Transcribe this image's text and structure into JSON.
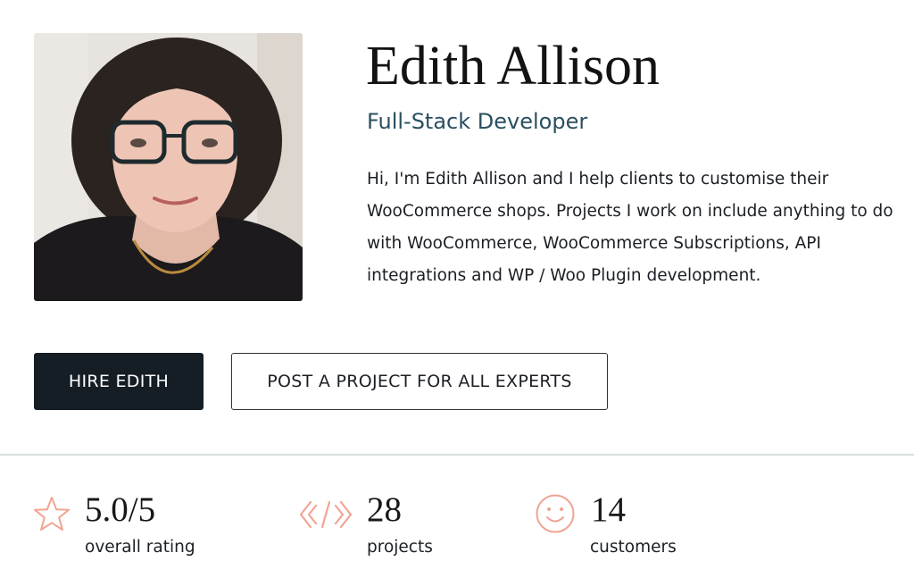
{
  "profile": {
    "name": "Edith Allison",
    "role": "Full-Stack Developer",
    "bio": "Hi, I'm Edith Allison and I help clients to customise their WooCommerce shops. Projects I work on include anything to do with WooCommerce, WooCommerce Subscriptions, API integrations and WP / Woo Plugin development."
  },
  "actions": {
    "hire_label": "HIRE EDITH",
    "post_label": "POST A PROJECT FOR ALL EXPERTS"
  },
  "stats": [
    {
      "icon": "star-icon",
      "value": "5.0/5",
      "label": "overall rating"
    },
    {
      "icon": "code-icon",
      "value": "28",
      "label": "projects"
    },
    {
      "icon": "smiley-icon",
      "value": "14",
      "label": "customers"
    }
  ],
  "colors": {
    "accent_icon": "#f0a493",
    "role_text": "#2b4f60",
    "primary_button": "#151d25"
  }
}
